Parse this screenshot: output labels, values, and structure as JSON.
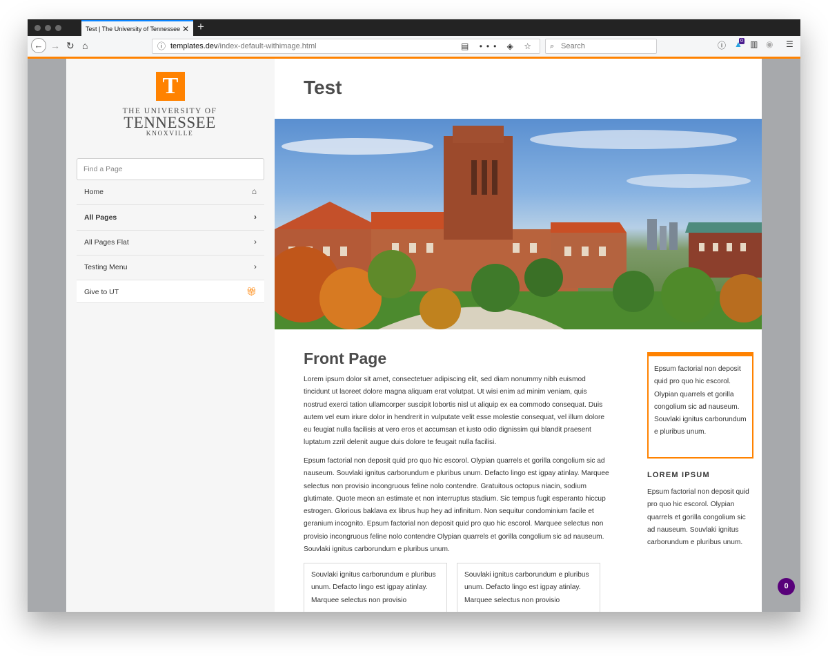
{
  "browser": {
    "tab_title": "Test | The University of Tennessee,",
    "tab_close": "✕",
    "new_tab": "+",
    "url_host": "templates.dev",
    "url_path": "/index-default-withimage.html",
    "search_placeholder": "Search",
    "extension_badge": "0"
  },
  "sidebar": {
    "logo_letter": "T",
    "logo_line1": "THE UNIVERSITY OF",
    "logo_line2": "TENNESSEE",
    "logo_line3": "KNOXVILLE",
    "search_placeholder": "Find a Page",
    "items": [
      {
        "label": "Home",
        "icon": "home-icon"
      },
      {
        "label": "All Pages",
        "icon": "chevron-right-icon"
      },
      {
        "label": "All Pages Flat",
        "icon": "chevron-right-icon"
      },
      {
        "label": "Testing Menu",
        "icon": "chevron-right-icon"
      },
      {
        "label": "Give to UT",
        "icon": "gift-icon"
      }
    ]
  },
  "main": {
    "page_title": "Test",
    "section_title": "Front Page",
    "paragraph1": "Lorem ipsum dolor sit amet, consectetuer adipiscing elit, sed diam nonummy nibh euismod tincidunt ut laoreet dolore magna aliquam erat volutpat. Ut wisi enim ad minim veniam, quis nostrud exerci tation ullamcorper suscipit lobortis nisl ut aliquip ex ea commodo consequat. Duis autem vel eum iriure dolor in hendrerit in vulputate velit esse molestie consequat, vel illum dolore eu feugiat nulla facilisis at vero eros et accumsan et iusto odio dignissim qui blandit praesent luptatum zzril delenit augue duis dolore te feugait nulla facilisi.",
    "paragraph2": "Epsum factorial non deposit quid pro quo hic escorol. Olypian quarrels et gorilla congolium sic ad nauseum. Souvlaki ignitus carborundum e pluribus unum. Defacto lingo est igpay atinlay. Marquee selectus non provisio incongruous feline nolo contendre. Gratuitous octopus niacin, sodium glutimate. Quote meon an estimate et non interruptus stadium. Sic tempus fugit esperanto hiccup estrogen. Glorious baklava ex librus hup hey ad infinitum. Non sequitur condominium facile et geranium incognito. Epsum factorial non deposit quid pro quo hic escorol. Marquee selectus non provisio incongruous feline nolo contendre Olypian quarrels et gorilla congolium sic ad nauseum. Souvlaki ignitus carborundum e pluribus unum.",
    "card1": "Souvlaki ignitus carborundum e pluribus unum. Defacto lingo est igpay atinlay. Marquee selectus non provisio",
    "card2": "Souvlaki ignitus carborundum e pluribus unum. Defacto lingo est igpay atinlay. Marquee selectus non provisio"
  },
  "aside": {
    "callout_text": "Epsum factorial non deposit quid pro quo hic escorol. Olypian quarrels et gorilla congolium sic ad nauseum. Souvlaki ignitus carborundum e pluribus unum.",
    "heading": "LOREM IPSUM",
    "text": "Epsum factorial non deposit quid pro quo hic escorol. Olypian quarrels et gorilla congolium sic ad nauseum. Souvlaki ignitus carborundum e pluribus unum."
  },
  "floating_badge": "0",
  "colors": {
    "accent_orange": "#ff8200",
    "badge_purple": "#58007a",
    "text_dark": "#4b4b4b"
  }
}
